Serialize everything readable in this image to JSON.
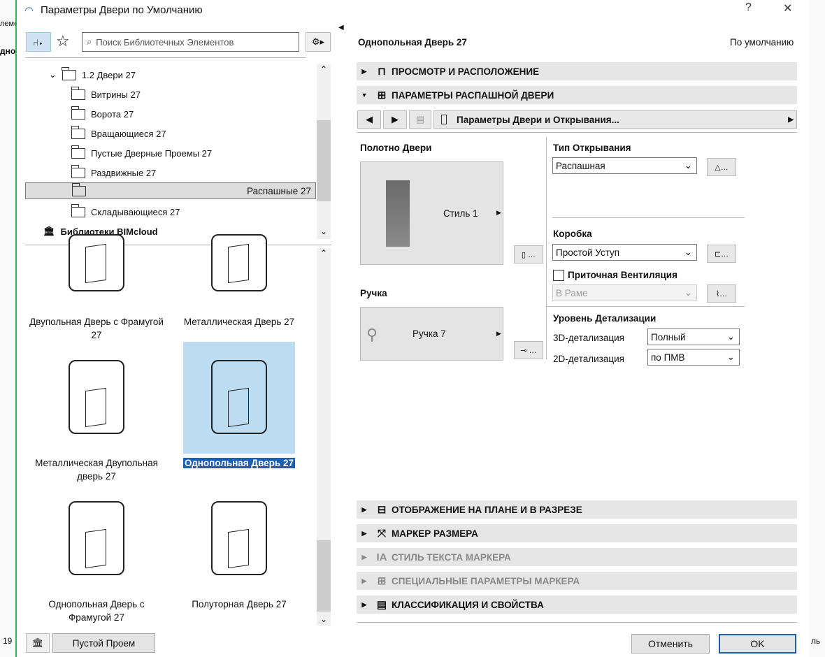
{
  "window": {
    "title": "Параметры Двери по Умолчанию",
    "help": "?",
    "close": "✕"
  },
  "background": {
    "left_top": "леме",
    "left_mid": "дно",
    "left_bottom": "19",
    "right_bottom": "ль"
  },
  "search": {
    "placeholder": "Поиск Библиотечных Элементов"
  },
  "tree": {
    "root": "1.2 Двери 27",
    "items": [
      "Витрины 27",
      "Ворота 27",
      "Вращающиеся 27",
      "Пустые Дверные Проемы 27",
      "Раздвижные 27",
      "Распашные 27",
      "Складывающиеся 27"
    ],
    "selected": "Распашные 27",
    "library": "Библиотеки BIMcloud"
  },
  "grid": {
    "items": [
      "Двупольная Дверь с Фрамугой 27",
      "Металлическая Дверь 27",
      "Металлическая Двупольная дверь 27",
      "Однопольная Дверь 27",
      "Однопольная Дверь с Фрамугой 27",
      "Полуторная Дверь 27"
    ],
    "selected": "Однопольная Дверь 27"
  },
  "footer_left": {
    "empty_opening": "Пустой Проем"
  },
  "right": {
    "element_name": "Однопольная Дверь 27",
    "default_label": "По умолчанию",
    "sections": [
      "ПРОСМОТР И РАСПОЛОЖЕНИЕ",
      "ПАРАМЕТРЫ РАСПАШНОЙ ДВЕРИ",
      "ОТОБРАЖЕНИЕ НА ПЛАНЕ И В РАЗРЕЗЕ",
      "МАРКЕР РАЗМЕРА",
      "СТИЛЬ ТЕКСТА МАРКЕРА",
      "СПЕЦИАЛЬНЫЕ ПАРАМЕТРЫ МАРКЕРА",
      "КЛАССИФИКАЦИЯ И СВОЙСТВА"
    ],
    "page_select": "Параметры Двери и Открывания...",
    "leaf_label": "Полотно Двери",
    "leaf_style": "Стиль 1",
    "handle_label": "Ручка",
    "handle_style": "Ручка 7",
    "opening_type_label": "Тип Открывания",
    "opening_type": "Распашная",
    "frame_label": "Коробка",
    "frame": "Простой Уступ",
    "vent_label": "Приточная Вентиляция",
    "vent_checked": false,
    "vent_value": "В Раме",
    "detail_label": "Уровень Детализации",
    "detail_3d_label": "3D-детализация",
    "detail_3d": "Полный",
    "detail_2d_label": "2D-детализация",
    "detail_2d": "по ПМВ",
    "cancel": "Отменить",
    "ok": "OK"
  }
}
